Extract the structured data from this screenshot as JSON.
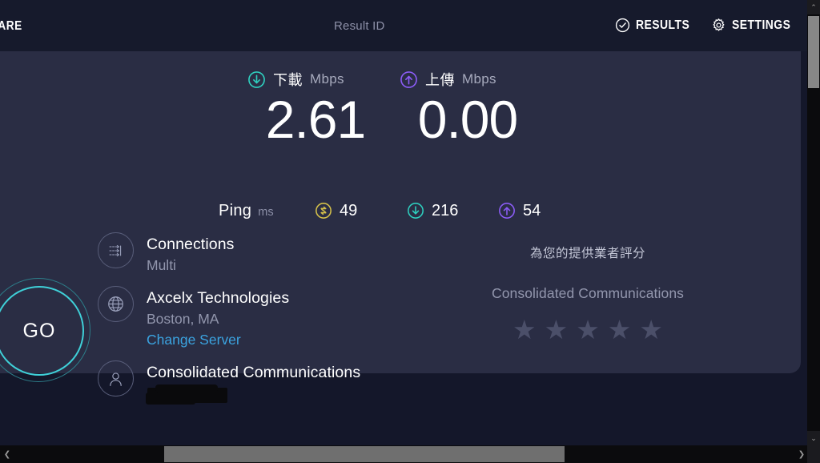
{
  "header": {
    "share_label": "HARE",
    "result_id_label": "Result ID",
    "results_label": "RESULTS",
    "settings_label": "SETTINGS"
  },
  "speeds": {
    "download": {
      "icon": "download-arrow-icon",
      "name": "下載",
      "unit": "Mbps",
      "value": "2.61",
      "color": "#2ecfbf"
    },
    "upload": {
      "icon": "upload-arrow-icon",
      "name": "上傳",
      "unit": "Mbps",
      "value": "0.00",
      "color": "#8b5cf6"
    }
  },
  "ping": {
    "label": "Ping",
    "unit": "ms",
    "idle": {
      "icon": "idle-latency-icon",
      "value": "49",
      "color": "#d4c04a"
    },
    "download": {
      "icon": "download-arrow-icon",
      "value": "216",
      "color": "#2ecfbf"
    },
    "upload": {
      "icon": "upload-arrow-icon",
      "value": "54",
      "color": "#8b5cf6"
    }
  },
  "go_button": {
    "label": "GO",
    "ring_color": "#3fd0d8"
  },
  "connection": {
    "connections": {
      "icon": "multi-connection-icon",
      "title": "Connections",
      "subtitle": "Multi"
    },
    "server": {
      "icon": "globe-icon",
      "title": "Axcelx Technologies",
      "subtitle": "Boston, MA",
      "change_link": "Change Server"
    },
    "isp": {
      "icon": "person-icon",
      "title": "Consolidated Communications",
      "ip_redacted": true
    }
  },
  "rating": {
    "prompt": "為您的提供業者評分",
    "provider": "Consolidated Communications",
    "stars": [
      "★",
      "★",
      "★",
      "★",
      "★"
    ],
    "selected": 0,
    "star_color": "#4b4f69"
  },
  "scrollbars": {
    "vertical_up": "⌃",
    "vertical_down": "⌄",
    "horizontal_left": "❮",
    "horizontal_right": "❯"
  }
}
